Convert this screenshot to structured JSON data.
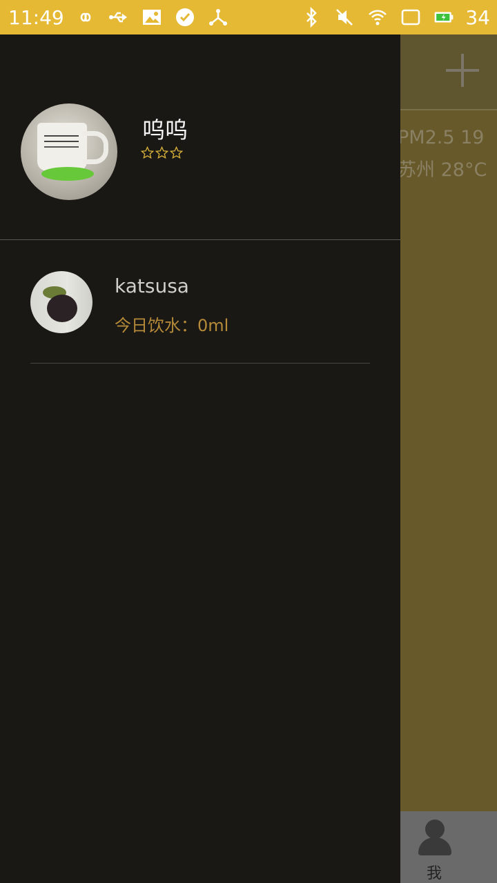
{
  "status_bar": {
    "time": "11:49",
    "battery_level": "34",
    "left_icons": [
      "infinity-icon",
      "usb-icon",
      "image-icon",
      "check-circle-icon",
      "share-icon"
    ],
    "right_icons": [
      "bluetooth-icon",
      "mute-icon",
      "wifi-icon",
      "screen-icon",
      "battery-icon"
    ],
    "bar_color": "#e5b933"
  },
  "background_page": {
    "pm25": "PM2.5  19",
    "weather": "苏州  28°C",
    "me_tab_label": "我"
  },
  "drawer": {
    "profile": {
      "name": "呜呜",
      "stars": 3
    },
    "friends": [
      {
        "name": "katsusa",
        "water_today": "今日饮水：0ml"
      }
    ]
  }
}
